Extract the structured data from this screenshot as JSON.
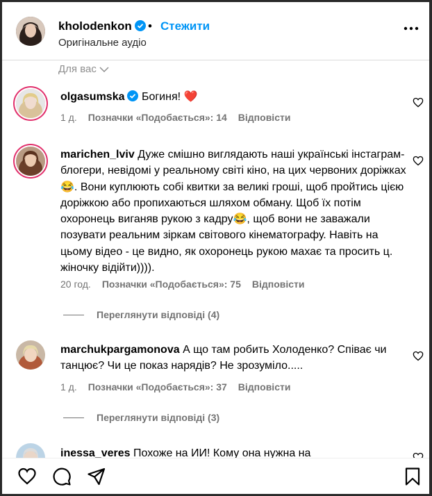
{
  "header": {
    "username": "kholodenkon",
    "follow_label": "Стежити",
    "separator": "•",
    "audio_label": "Оригінальне аудіо"
  },
  "sort_label": "Для вас",
  "comments": [
    {
      "user": "olgasumska",
      "verified": true,
      "text": "Богиня! ❤️",
      "time": "1 д.",
      "likes": "Позначки «Подобається»: 14",
      "reply": "Відповісти"
    },
    {
      "user": "marichen_lviv",
      "verified": false,
      "text": "Дуже смішно виглядають наші українські інстаграм-блогери, невідомі у реальному світі кіно, на цих червоних доріжках😂. Вони куплюють собі квитки за великі гроші, щоб пройтись цією доріжкою або пропихаються шляхом обману. Щоб їх потім охоронець виганяв рукою з кадру😂, щоб вони не заважали позувати реальним зіркам світового кінематографу. Навіть на цьому відео - це видно, як охоронець рукою махає та просить ц. жіночку відійти)))).",
      "time": "20 год.",
      "likes": "Позначки «Подобається»: 75",
      "reply": "Відповісти",
      "view_replies": "Переглянути відповіді (4)"
    },
    {
      "user": "marchukpargamonova",
      "verified": false,
      "text": "А що там робить Холоденко? Співає чи танцює? Чи це показ нарядів? Не зрозуміло.....",
      "time": "1 д.",
      "likes": "Позначки «Подобається»: 37",
      "reply": "Відповісти",
      "view_replies": "Переглянути відповіді (3)"
    },
    {
      "user": "inessa_veres",
      "verified": false,
      "text": "Похоже на ИИ! Кому она нужна на"
    }
  ],
  "colors": {
    "accent": "#0095f6",
    "verified": "#0095f6",
    "meta": "#737373",
    "heart": "#ed4956"
  },
  "icons": [
    "verified-icon",
    "more-icon",
    "chevron-down-icon",
    "heart-icon",
    "comment-icon",
    "share-icon",
    "bookmark-icon"
  ]
}
